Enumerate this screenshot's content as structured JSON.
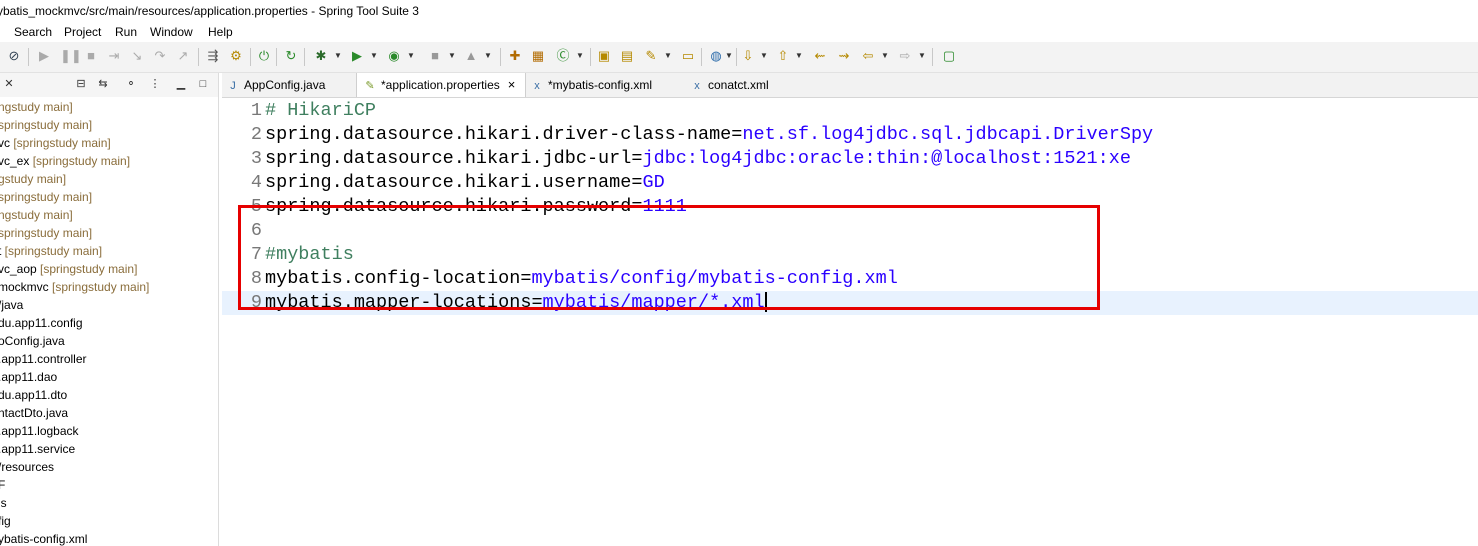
{
  "window": {
    "title": "ybatis_mockmvc/src/main/resources/application.properties - Spring Tool Suite 3"
  },
  "menu": {
    "items": [
      "Search",
      "Project",
      "Run",
      "Window",
      "Help"
    ]
  },
  "explorer": {
    "items": [
      {
        "prefix": "",
        "decor": "ngstudy main]"
      },
      {
        "prefix": "",
        "decor": "springstudy main]"
      },
      {
        "prefix": "vc ",
        "decor": "[springstudy main]"
      },
      {
        "prefix": "vc_ex ",
        "decor": "[springstudy main]"
      },
      {
        "prefix": "",
        "decor": "gstudy main]"
      },
      {
        "prefix": "",
        "decor": "springstudy main]"
      },
      {
        "prefix": "",
        "decor": "ngstudy main]"
      },
      {
        "prefix": "",
        "decor": "springstudy main]"
      },
      {
        "prefix": "t ",
        "decor": "[springstudy main]"
      },
      {
        "prefix": "vc_aop ",
        "decor": "[springstudy main]"
      },
      {
        "prefix": "mockmvc ",
        "decor": "[springstudy main]"
      },
      {
        "prefix": "/java",
        "decor": ""
      },
      {
        "prefix": "du.app11.config",
        "decor": ""
      },
      {
        "prefix": "oConfig.java",
        "decor": ""
      },
      {
        "prefix": ".app11.controller",
        "decor": ""
      },
      {
        "prefix": ".app11.dao",
        "decor": ""
      },
      {
        "prefix": "du.app11.dto",
        "decor": ""
      },
      {
        "prefix": "ntactDto.java",
        "decor": ""
      },
      {
        "prefix": ".app11.logback",
        "decor": ""
      },
      {
        "prefix": ".app11.service",
        "decor": ""
      },
      {
        "prefix": "/resources",
        "decor": ""
      },
      {
        "prefix": "F",
        "decor": ""
      },
      {
        "prefix": "is",
        "decor": ""
      },
      {
        "prefix": "fig",
        "decor": ""
      },
      {
        "prefix": "ybatis-config.xml",
        "decor": ""
      }
    ]
  },
  "tabs": [
    {
      "label": "AppConfig.java",
      "icon": "java-file-icon",
      "active": false
    },
    {
      "label": "*application.properties",
      "icon": "properties-file-icon",
      "active": true,
      "close": "×"
    },
    {
      "label": "*mybatis-config.xml",
      "icon": "xml-file-icon",
      "active": false
    },
    {
      "label": "conatct.xml",
      "icon": "xml-file-icon",
      "active": false
    }
  ],
  "editor": {
    "lines": [
      {
        "n": "1",
        "parts": [
          {
            "t": "# HikariCP",
            "c": "cmt"
          }
        ]
      },
      {
        "n": "2",
        "parts": [
          {
            "t": "spring.datasource.hikari.driver-class-name=",
            "c": "key"
          },
          {
            "t": "net.sf.log4jdbc.sql.jdbcapi.DriverSpy",
            "c": "val"
          }
        ]
      },
      {
        "n": "3",
        "parts": [
          {
            "t": "spring.datasource.hikari.jdbc-url=",
            "c": "key"
          },
          {
            "t": "jdbc:log4jdbc:oracle:thin:@localhost:1521:xe",
            "c": "val"
          }
        ]
      },
      {
        "n": "4",
        "parts": [
          {
            "t": "spring.datasource.hikari.username=",
            "c": "key"
          },
          {
            "t": "GD",
            "c": "val"
          }
        ]
      },
      {
        "n": "5",
        "parts": [
          {
            "t": "spring.datasource.hikari.password=",
            "c": "key"
          },
          {
            "t": "1111",
            "c": "val"
          }
        ]
      },
      {
        "n": "6",
        "parts": []
      },
      {
        "n": "7",
        "parts": [
          {
            "t": "#mybatis",
            "c": "cmt"
          }
        ]
      },
      {
        "n": "8",
        "parts": [
          {
            "t": "mybatis.config-location=",
            "c": "key"
          },
          {
            "t": "mybatis/config/mybatis-config.xml",
            "c": "val"
          }
        ]
      },
      {
        "n": "9",
        "parts": [
          {
            "t": "mybatis.mapper-locations=",
            "c": "key"
          },
          {
            "t": "mybatis/mapper/*.xml",
            "c": "val"
          }
        ]
      }
    ],
    "current_line": 9
  },
  "colors": {
    "highlight_box": "#e60000",
    "comment": "#3f7f5f",
    "value": "#2a00ff",
    "current_line": "#e8f2fe"
  }
}
